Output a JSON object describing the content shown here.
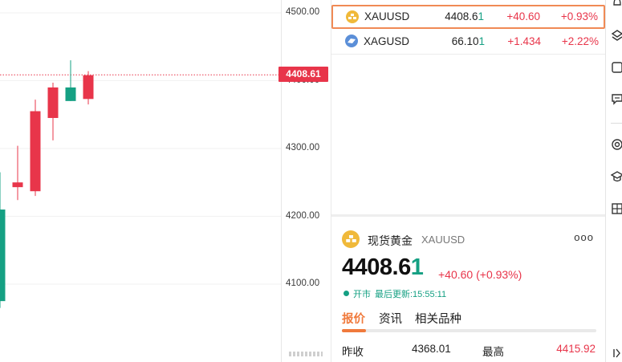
{
  "chart_data": {
    "type": "candlestick",
    "ylim": [
      4100,
      4500
    ],
    "ticks": [
      "4500.00",
      "4400.00",
      "4300.00",
      "4200.00",
      "4100.00"
    ],
    "current_price_label": "4408.61",
    "current_price": 4408.61,
    "candles": [
      {
        "open": 4210,
        "high": 4265,
        "low": 4065,
        "close": 4075
      },
      {
        "open": 4243,
        "high": 4304,
        "low": 4224,
        "close": 4250
      },
      {
        "open": 4237,
        "high": 4372,
        "low": 4230,
        "close": 4355
      },
      {
        "open": 4345,
        "high": 4397,
        "low": 4312,
        "close": 4390
      },
      {
        "open": 4390,
        "high": 4430,
        "low": 4370,
        "close": 4370
      },
      {
        "open": 4373,
        "high": 4414,
        "low": 4365,
        "close": 4408
      }
    ],
    "up_color": "#e8354a",
    "down_color": "#15a083"
  },
  "watchlist": [
    {
      "symbol": "XAUUSD",
      "price_main": "4408.6",
      "price_last": "1",
      "change": "+40.60",
      "percent": "+0.93%",
      "icon": "gold-coin-icon",
      "icon_color": "#f0b93a"
    },
    {
      "symbol": "XAGUSD",
      "price_main": "66.10",
      "price_last": "1",
      "change": "+1.434",
      "percent": "+2.22%",
      "icon": "silver-coin-icon",
      "icon_color": "#5b8fd8"
    }
  ],
  "detail": {
    "name": "现货黄金",
    "symbol": "XAUUSD",
    "more": "ooo",
    "price_main": "4408.6",
    "price_last": "1",
    "change": "+40.60 (+0.93%)",
    "status": "开市",
    "updated": "最后更新:15:55:11",
    "tabs": [
      "报价",
      "资讯",
      "相关品种"
    ],
    "stats": {
      "prev_close_label": "昨收",
      "prev_close_value": "4368.01",
      "high_label": "最高",
      "high_value": "4415.92"
    }
  },
  "colors": {
    "accent": "#f07a3c",
    "up": "#e8354a",
    "down": "#15a083"
  }
}
